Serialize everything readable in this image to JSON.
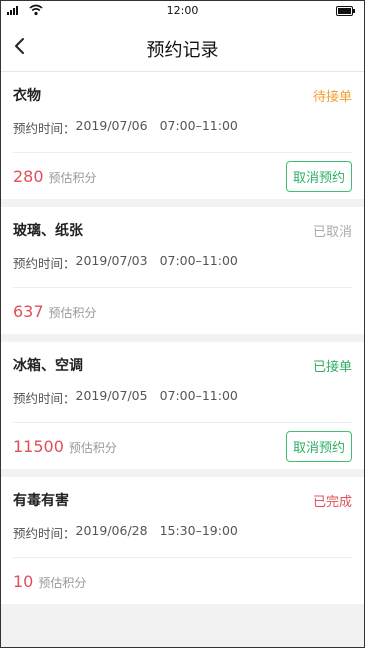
{
  "statusbar": {
    "time": "12:00"
  },
  "header": {
    "title": "预约记录"
  },
  "labels": {
    "time_prefix": "预约时间：",
    "points_suffix": "预估积分",
    "cancel_label": "取消预约"
  },
  "colors": {
    "pending": "#f0a030",
    "cancelled": "#aaaaaa",
    "accepted": "#2fae64",
    "completed": "#e0505a",
    "points": "#e0505a"
  },
  "records": [
    {
      "category": "衣物",
      "status": "待接单",
      "date": "2019/07/06",
      "time_range": "07:00–11:00",
      "points": "280",
      "can_cancel": true
    },
    {
      "category": "玻璃、纸张",
      "status": "已取消",
      "date": "2019/07/03",
      "time_range": "07:00–11:00",
      "points": "637",
      "can_cancel": false
    },
    {
      "category": "冰箱、空调",
      "status": "已接单",
      "date": "2019/07/05",
      "time_range": "07:00–11:00",
      "points": "11500",
      "can_cancel": true
    },
    {
      "category": "有毒有害",
      "status": "已完成",
      "date": "2019/06/28",
      "time_range": "15:30–19:00",
      "points": "10",
      "can_cancel": false
    }
  ]
}
